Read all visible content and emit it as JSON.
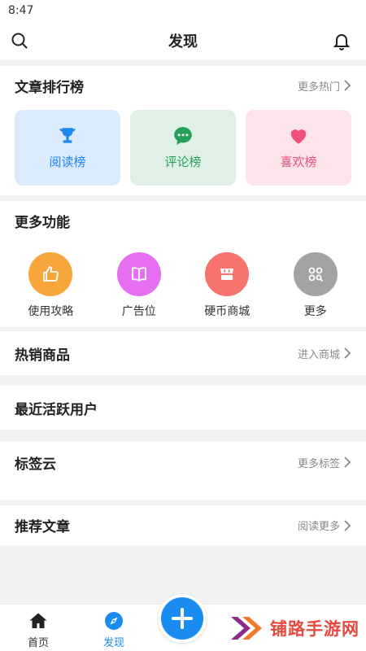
{
  "status_bar": {
    "time": "8:47"
  },
  "header": {
    "title": "发现"
  },
  "ranking": {
    "title": "文章排行榜",
    "more": "更多热门",
    "cards": [
      {
        "label": "阅读榜",
        "icon": "trophy-icon",
        "bg": "#dbeafd",
        "color": "#1e86ec"
      },
      {
        "label": "评论榜",
        "icon": "comment-icon",
        "bg": "#dff1e6",
        "color": "#27a05a"
      },
      {
        "label": "喜欢榜",
        "icon": "heart-icon",
        "bg": "#fde3ea",
        "color": "#f0517c"
      }
    ]
  },
  "functions": {
    "title": "更多功能",
    "items": [
      {
        "label": "使用攻略",
        "icon": "thumbs-up-icon",
        "color": "#f7a63b"
      },
      {
        "label": "广告位",
        "icon": "book-icon",
        "color": "#e66ef0"
      },
      {
        "label": "硬币商城",
        "icon": "shop-icon",
        "color": "#f7736e"
      },
      {
        "label": "更多",
        "icon": "more-apps-icon",
        "color": "#a3a3a3"
      }
    ]
  },
  "hot_products": {
    "title": "热销商品",
    "more": "进入商城"
  },
  "active_users": {
    "title": "最近活跃用户"
  },
  "tag_cloud": {
    "title": "标签云",
    "more": "更多标签"
  },
  "recommended": {
    "title": "推荐文章",
    "more": "阅读更多"
  },
  "tabbar": {
    "items": [
      {
        "label": "首页",
        "icon": "home-icon"
      },
      {
        "label": "发现",
        "icon": "compass-icon",
        "active": true
      }
    ],
    "fab": "plus-icon",
    "active_color": "#1a8cf0"
  },
  "watermark": {
    "text": "铺路手游网"
  }
}
